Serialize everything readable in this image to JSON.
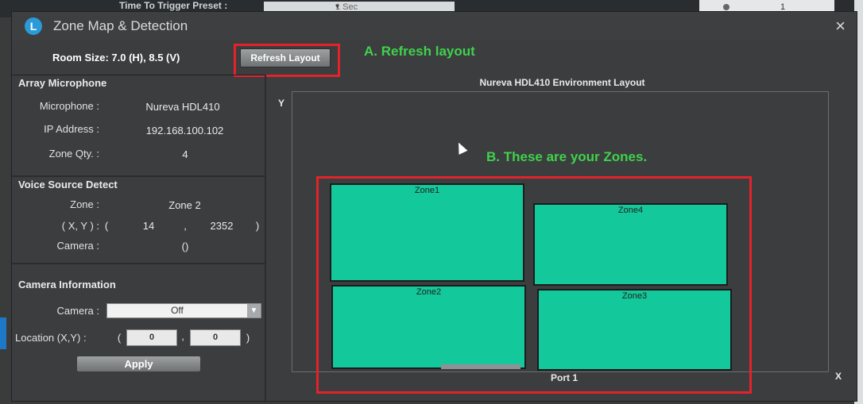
{
  "background": {
    "top_label": "Time To Trigger Preset :",
    "top_select_value": "1 Sec",
    "top_right_value": "1"
  },
  "dialog": {
    "title": "Zone Map & Detection",
    "logo_letter": "L",
    "close_glyph": "×"
  },
  "toolbar": {
    "room_size": "Room Size:  7.0 (H), 8.5 (V)",
    "refresh_label": "Refresh Layout"
  },
  "annotations": {
    "a": "A. Refresh layout",
    "b": "B. These are your Zones."
  },
  "array_microphone": {
    "heading": "Array Microphone",
    "microphone_label": "Microphone :",
    "microphone_value": "Nureva HDL410",
    "ip_label": "IP Address :",
    "ip_value": "192.168.100.102",
    "zone_qty_label": "Zone Qty. :",
    "zone_qty_value": "4"
  },
  "voice_source": {
    "heading": "Voice Source Detect",
    "zone_label": "Zone :",
    "zone_value": "Zone 2",
    "xy_label": "( X, Y ) :",
    "open_paren": "(",
    "x_value": "14",
    "comma": ",",
    "y_value": "2352",
    "close_paren": ")",
    "camera_label": "Camera :",
    "camera_value": "()"
  },
  "camera_info": {
    "heading": "Camera Information",
    "camera_label": "Camera :",
    "camera_value": "Off",
    "location_label": "Location (X,Y) :",
    "open_paren": "(",
    "x_value": "0",
    "comma": ",",
    "y_value": "0",
    "close_paren": ")",
    "apply_label": "Apply"
  },
  "layout": {
    "title": "Nureva HDL410 Environment Layout",
    "y_axis": "Y",
    "x_axis": "X",
    "port_label": "Port 1",
    "zones": [
      {
        "name": "Zone1"
      },
      {
        "name": "Zone4"
      },
      {
        "name": "Zone2"
      },
      {
        "name": "Zone3"
      }
    ]
  },
  "colors": {
    "zone_fill": "#13c89a",
    "highlight": "#e3232b",
    "annotation": "#3fd24c",
    "accent": "#2b9ad8"
  }
}
